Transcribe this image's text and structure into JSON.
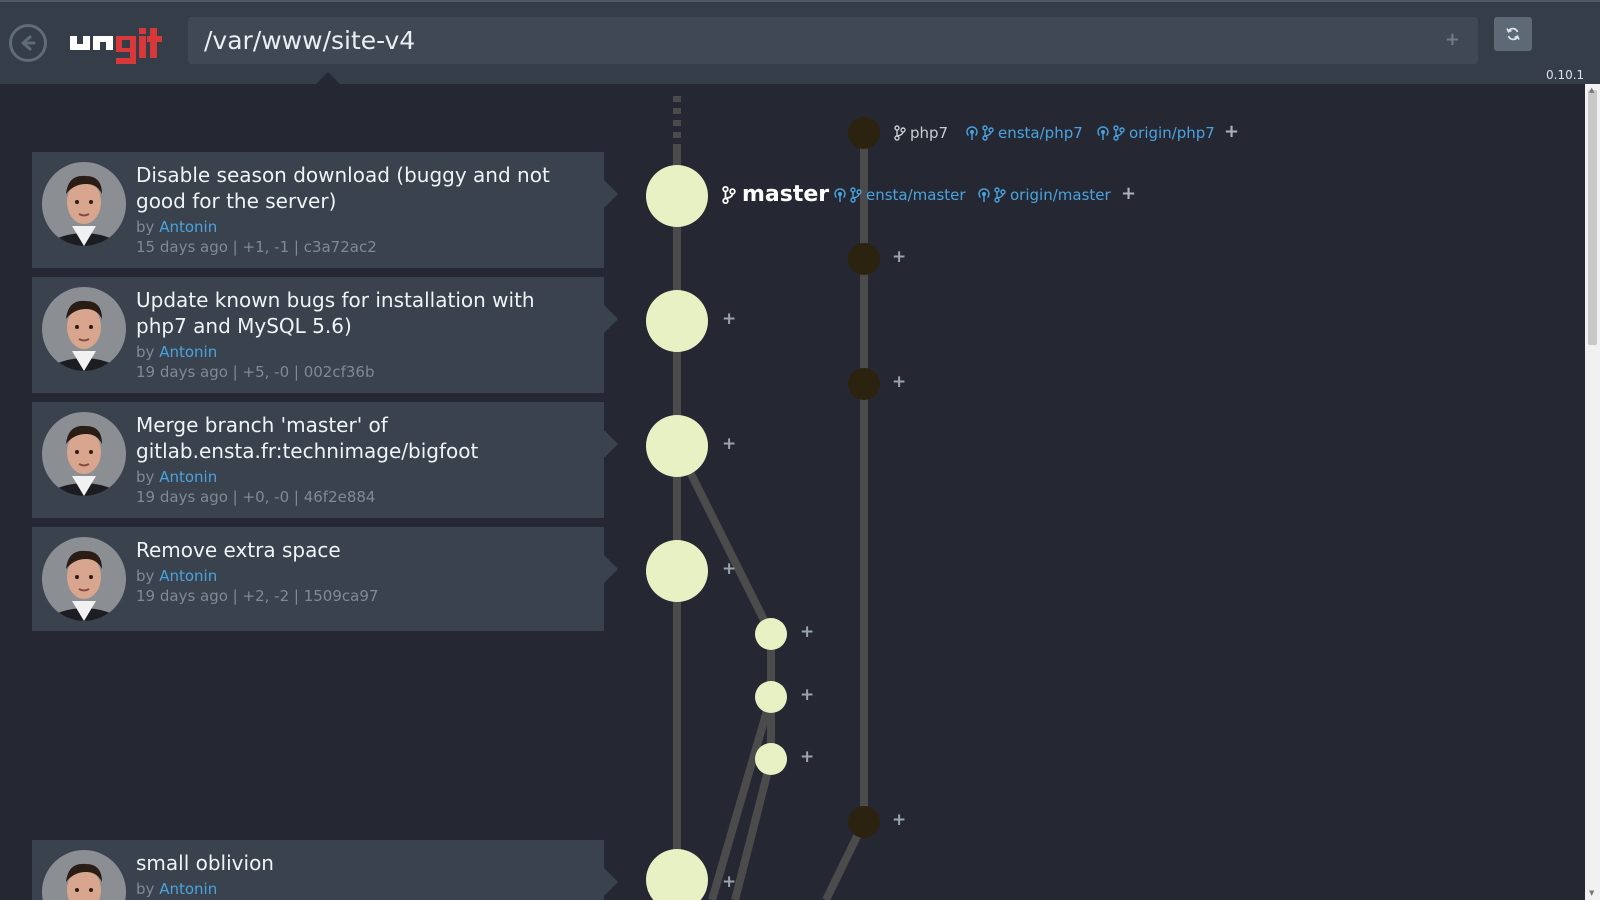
{
  "header": {
    "path": "/var/www/site-v4",
    "path_add": "+",
    "version": "0.10.1",
    "logo_text": "ungit"
  },
  "commits": [
    {
      "title": "Disable season download (buggy and not good for the server)",
      "by_prefix": "by",
      "author": "Antonin",
      "meta": "15 days ago | +1, -1 | c3a72ac2"
    },
    {
      "title": "Update known bugs for installation with php7 and MySQL 5.6)",
      "by_prefix": "by",
      "author": "Antonin",
      "meta": "19 days ago | +5, -0 | 002cf36b"
    },
    {
      "title": "Merge branch 'master' of gitlab.ensta.fr:technimage/bigfoot",
      "by_prefix": "by",
      "author": "Antonin",
      "meta": "19 days ago | +0, -0 | 46f2e884"
    },
    {
      "title": "Remove extra space",
      "by_prefix": "by",
      "author": "Antonin",
      "meta": "19 days ago | +2, -2 | 1509ca97"
    },
    {
      "title": "small oblivion",
      "by_prefix": "by",
      "author": "Antonin",
      "meta": ""
    }
  ],
  "refs": {
    "php7": {
      "local": "php7",
      "remotes": [
        "ensta/php7",
        "origin/php7"
      ],
      "add": "+"
    },
    "master": {
      "local": "master",
      "remotes": [
        "ensta/master",
        "origin/master"
      ],
      "add": "+"
    }
  },
  "node_add": "+",
  "colors": {
    "background": "#252833",
    "header": "#353e48",
    "card": "#3a424d",
    "node_light": "#e7f1c4",
    "node_dark": "#2b2310",
    "edge": "#4b4b4b",
    "link": "#4aa3df"
  }
}
